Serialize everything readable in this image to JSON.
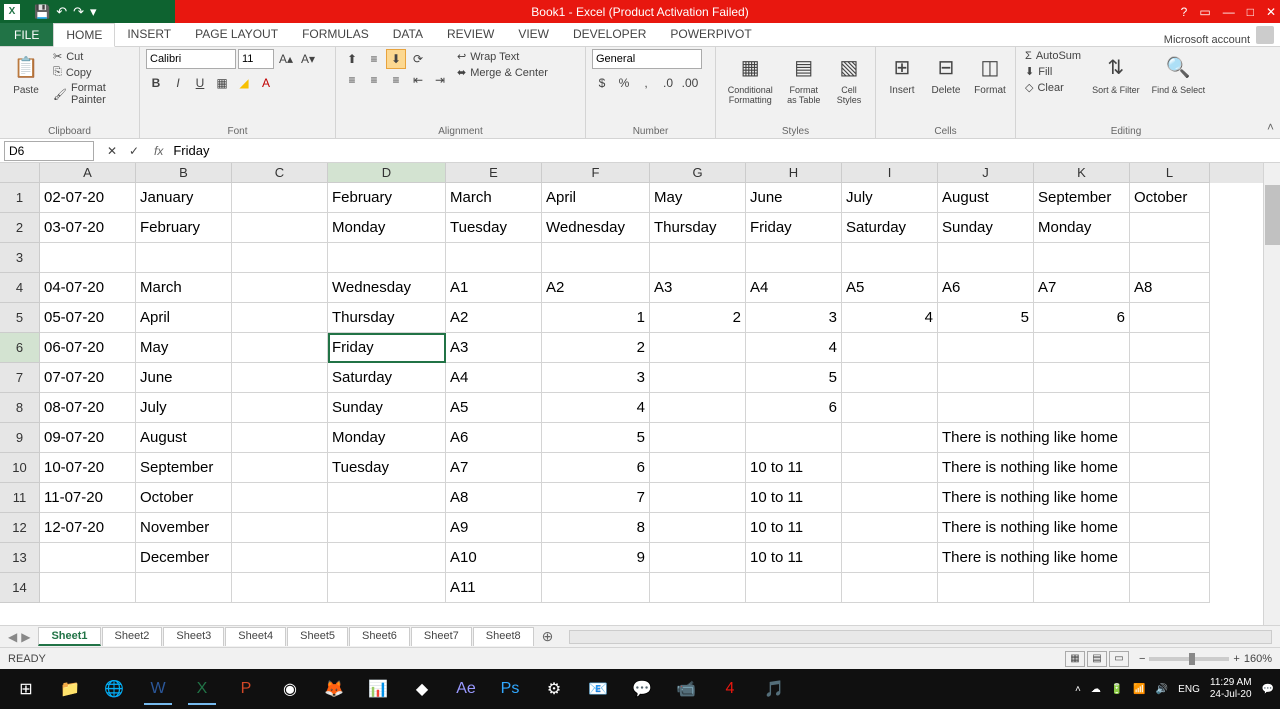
{
  "titlebar": {
    "title": "Book1 - Excel (Product Activation Failed)"
  },
  "ribbon_tabs": {
    "file": "FILE",
    "items": [
      "HOME",
      "INSERT",
      "PAGE LAYOUT",
      "FORMULAS",
      "DATA",
      "REVIEW",
      "VIEW",
      "DEVELOPER",
      "POWERPIVOT"
    ],
    "active": "HOME",
    "account": "Microsoft account"
  },
  "ribbon": {
    "clipboard": {
      "label": "Clipboard",
      "paste": "Paste",
      "cut": "Cut",
      "copy": "Copy",
      "painter": "Format Painter"
    },
    "font": {
      "label": "Font",
      "name": "Calibri",
      "size": "11"
    },
    "alignment": {
      "label": "Alignment",
      "wrap": "Wrap Text",
      "merge": "Merge & Center"
    },
    "number": {
      "label": "Number",
      "format": "General"
    },
    "styles": {
      "label": "Styles",
      "cond": "Conditional Formatting",
      "table": "Format as Table",
      "cell": "Cell Styles"
    },
    "cells": {
      "label": "Cells",
      "insert": "Insert",
      "delete": "Delete",
      "format": "Format"
    },
    "editing": {
      "label": "Editing",
      "autosum": "AutoSum",
      "fill": "Fill",
      "clear": "Clear",
      "sort": "Sort & Filter",
      "find": "Find & Select"
    }
  },
  "formula_bar": {
    "name": "D6",
    "value": "Friday"
  },
  "columns": [
    "A",
    "B",
    "C",
    "D",
    "E",
    "F",
    "G",
    "H",
    "I",
    "J",
    "K",
    "L"
  ],
  "active_col": "D",
  "active_row": 6,
  "chart_data": {
    "type": "table",
    "rows": [
      {
        "r": 1,
        "A": "02-07-20",
        "B": "January",
        "C": "",
        "D": "February",
        "E": "March",
        "F": "April",
        "G": "May",
        "H": "June",
        "I": "July",
        "J": "August",
        "K": "September",
        "L": "October"
      },
      {
        "r": 2,
        "A": "03-07-20",
        "B": "February",
        "C": "",
        "D": "Monday",
        "E": "Tuesday",
        "F": "Wednesday",
        "G": "Thursday",
        "H": "Friday",
        "I": "Saturday",
        "J": "Sunday",
        "K": "Monday",
        "L": ""
      },
      {
        "r": 3,
        "A": "",
        "B": "",
        "C": "",
        "D": "",
        "E": "",
        "F": "",
        "G": "",
        "H": "",
        "I": "",
        "J": "",
        "K": "",
        "L": ""
      },
      {
        "r": 4,
        "A": "04-07-20",
        "B": "March",
        "C": "",
        "D": "Wednesday",
        "E": "A1",
        "F": "A2",
        "G": "A3",
        "H": "A4",
        "I": "A5",
        "J": "A6",
        "K": "A7",
        "L": "A8"
      },
      {
        "r": 5,
        "A": "05-07-20",
        "B": "April",
        "C": "",
        "D": "Thursday",
        "E": "A2",
        "F": "1",
        "G": "2",
        "H": "3",
        "I": "4",
        "J": "5",
        "K": "6",
        "L": ""
      },
      {
        "r": 6,
        "A": "06-07-20",
        "B": "May",
        "C": "",
        "D": "Friday",
        "E": "A3",
        "F": "2",
        "G": "",
        "H": "4",
        "I": "",
        "J": "",
        "K": "",
        "L": ""
      },
      {
        "r": 7,
        "A": "07-07-20",
        "B": "June",
        "C": "",
        "D": "Saturday",
        "E": "A4",
        "F": "3",
        "G": "",
        "H": "5",
        "I": "",
        "J": "",
        "K": "",
        "L": ""
      },
      {
        "r": 8,
        "A": "08-07-20",
        "B": "July",
        "C": "",
        "D": "Sunday",
        "E": "A5",
        "F": "4",
        "G": "",
        "H": "6",
        "I": "",
        "J": "",
        "K": "",
        "L": ""
      },
      {
        "r": 9,
        "A": "09-07-20",
        "B": "August",
        "C": "",
        "D": "Monday",
        "E": "A6",
        "F": "5",
        "G": "",
        "H": "",
        "I": "",
        "J": "There is nothing like home",
        "K": "",
        "L": ""
      },
      {
        "r": 10,
        "A": "10-07-20",
        "B": "September",
        "C": "",
        "D": "Tuesday",
        "E": "A7",
        "F": "6",
        "G": "",
        "H": "10 to 11",
        "I": "",
        "J": "There is nothing like home",
        "K": "",
        "L": ""
      },
      {
        "r": 11,
        "A": "11-07-20",
        "B": "October",
        "C": "",
        "D": "",
        "E": "A8",
        "F": "7",
        "G": "",
        "H": "10 to 11",
        "I": "",
        "J": "There is nothing like home",
        "K": "",
        "L": ""
      },
      {
        "r": 12,
        "A": "12-07-20",
        "B": "November",
        "C": "",
        "D": "",
        "E": "A9",
        "F": "8",
        "G": "",
        "H": "10 to 11",
        "I": "",
        "J": "There is nothing like home",
        "K": "",
        "L": ""
      },
      {
        "r": 13,
        "A": "",
        "B": "December",
        "C": "",
        "D": "",
        "E": "A10",
        "F": "9",
        "G": "",
        "H": "10 to 11",
        "I": "",
        "J": "There is nothing like home",
        "K": "",
        "L": ""
      },
      {
        "r": 14,
        "A": "",
        "B": "",
        "C": "",
        "D": "",
        "E": "A11",
        "F": "",
        "G": "",
        "H": "",
        "I": "",
        "J": "",
        "K": "",
        "L": ""
      }
    ]
  },
  "numeric_cols_rows": {
    "F": [
      5,
      6,
      7,
      8,
      9,
      10,
      11,
      12,
      13
    ],
    "G": [
      5
    ],
    "H": [
      5,
      6,
      7,
      8
    ],
    "I": [
      5
    ],
    "J": [
      5
    ],
    "K": [
      5
    ]
  },
  "sheets": {
    "items": [
      "Sheet1",
      "Sheet2",
      "Sheet3",
      "Sheet4",
      "Sheet5",
      "Sheet6",
      "Sheet7",
      "Sheet8"
    ],
    "active": "Sheet1"
  },
  "statusbar": {
    "mode": "READY",
    "zoom": "160%"
  },
  "taskbar": {
    "lang": "ENG",
    "time": "11:29 AM",
    "date": "24-Jul-20"
  }
}
